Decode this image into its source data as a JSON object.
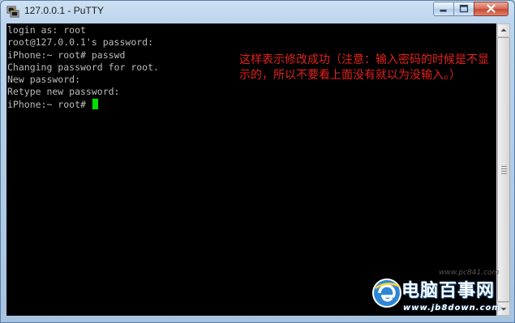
{
  "window": {
    "title": "127.0.0.1 - PuTTY",
    "icon": "putty-icon",
    "controls": {
      "minimize": "minimize-icon",
      "maximize": "maximize-icon",
      "close": "close-icon"
    }
  },
  "terminal": {
    "lines": [
      "login as: root",
      "root@127.0.0.1's password:",
      "iPhone:~ root# passwd",
      "Changing password for root.",
      "New password:",
      "Retype new password:",
      "iPhone:~ root# "
    ],
    "cursor_color": "#00e000",
    "text_color": "#bbbbbb",
    "background": "#000000"
  },
  "annotation": {
    "line1": "这样表示修改成功（注意：输入密码的时候是不显",
    "line2": "示的，所以不要看上面没有就以为没输入。）",
    "color": "#e2221b"
  },
  "watermark": {
    "text": "电脑百事网",
    "url_top": "www.pc841.com",
    "url_bottom": "www.jb8down.com"
  }
}
